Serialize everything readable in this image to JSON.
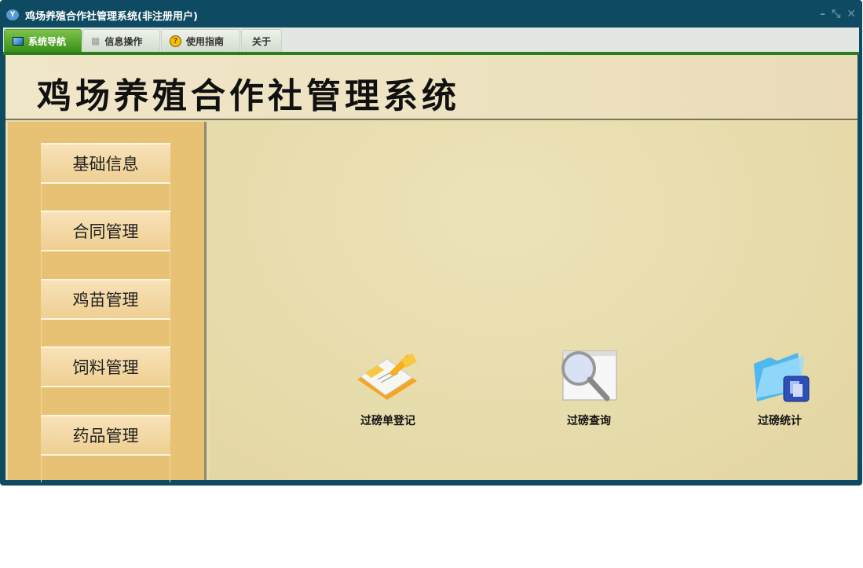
{
  "window": {
    "title": "鸡场养殖合作社管理系统(非注册用户)",
    "controls": {
      "minimize": "–",
      "restore": "⤡",
      "close": "✕"
    }
  },
  "tabs": [
    {
      "label": "系统导航",
      "icon": "monitor-icon",
      "active": true
    },
    {
      "label": "信息操作",
      "icon": "grid-icon",
      "active": false
    },
    {
      "label": "使用指南",
      "icon": "help-icon",
      "active": false
    },
    {
      "label": "关于",
      "active": false
    }
  ],
  "banner": {
    "title": "鸡场养殖合作社管理系统"
  },
  "sidebar": {
    "items": [
      {
        "label": "基础信息"
      },
      {
        "label": "合同管理"
      },
      {
        "label": "鸡苗管理"
      },
      {
        "label": "饲料管理"
      },
      {
        "label": "药品管理"
      }
    ]
  },
  "main": {
    "apps": [
      {
        "label": "过磅单登记",
        "icon": "notepad-pencil-icon"
      },
      {
        "label": "过磅查询",
        "icon": "magnifier-icon"
      },
      {
        "label": "过磅统计",
        "icon": "folder-icon"
      }
    ]
  }
}
